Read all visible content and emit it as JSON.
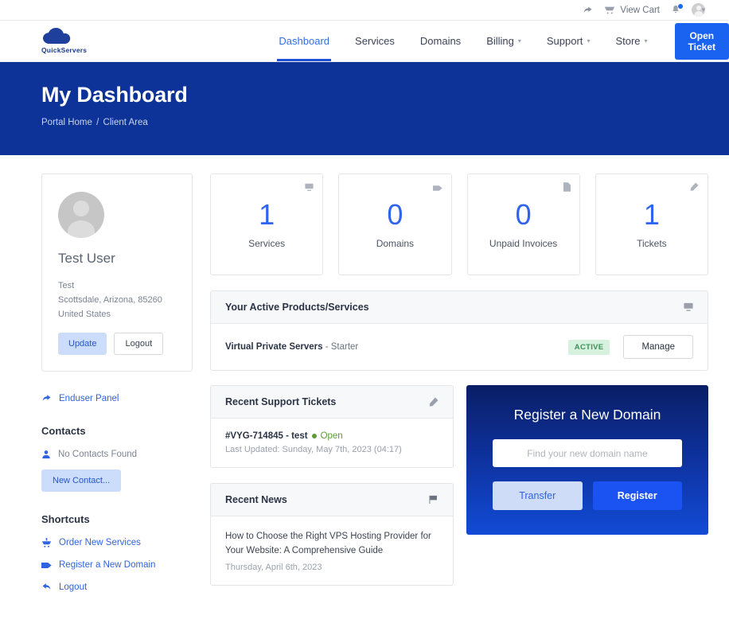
{
  "topbar": {
    "share_icon": "share-arrow-icon",
    "cart_icon": "shopping-cart-icon",
    "cart_label": "View Cart",
    "bell_icon": "bell-icon",
    "avatar_icon": "user-avatar-icon",
    "caret_icon": "chevron-down-icon"
  },
  "brand": {
    "logo_icon": "cloud-logo-icon",
    "name": "QuickServers"
  },
  "nav": {
    "items": [
      {
        "label": "Dashboard",
        "active": true,
        "caret": false
      },
      {
        "label": "Services",
        "active": false,
        "caret": false
      },
      {
        "label": "Domains",
        "active": false,
        "caret": false
      },
      {
        "label": "Billing",
        "active": false,
        "caret": true
      },
      {
        "label": "Support",
        "active": false,
        "caret": true
      },
      {
        "label": "Store",
        "active": false,
        "caret": true
      }
    ],
    "open_ticket_label": "Open Ticket"
  },
  "hero": {
    "title": "My Dashboard",
    "breadcrumb": [
      "Portal Home",
      "Client Area"
    ],
    "separator": "/",
    "bg_color": "#0d3398"
  },
  "profile": {
    "avatar_icon": "user-avatar-icon",
    "name": "Test User",
    "company": "Test",
    "address": "Scottsdale, Arizona, 85260",
    "country": "United States",
    "update_label": "Update",
    "logout_label": "Logout"
  },
  "sidebar": {
    "enduser_panel": {
      "label": "Enduser Panel",
      "icon": "arrow-forward-icon"
    },
    "contacts_heading": "Contacts",
    "contacts_empty": {
      "label": "No Contacts Found",
      "icon": "user-icon"
    },
    "new_contact_label": "New Contact...",
    "shortcuts_heading": "Shortcuts",
    "shortcuts": [
      {
        "label": "Order New Services",
        "icon": "cart-plus-icon"
      },
      {
        "label": "Register a New Domain",
        "icon": "tag-icon"
      },
      {
        "label": "Logout",
        "icon": "arrow-back-icon"
      }
    ]
  },
  "stats": [
    {
      "value": "1",
      "label": "Services",
      "icon": "server-icon"
    },
    {
      "value": "0",
      "label": "Domains",
      "icon": "tag-icon"
    },
    {
      "value": "0",
      "label": "Unpaid Invoices",
      "icon": "file-icon"
    },
    {
      "value": "1",
      "label": "Tickets",
      "icon": "ticket-icon"
    }
  ],
  "services_panel": {
    "title": "Your Active Products/Services",
    "icon": "server-icon",
    "rows": [
      {
        "product": "Virtual Private Servers",
        "plan": " - Starter",
        "status": "ACTIVE",
        "action_label": "Manage"
      }
    ]
  },
  "tickets_panel": {
    "title": "Recent Support Tickets",
    "icon": "ticket-icon",
    "rows": [
      {
        "id": "#VYG-714845 - test",
        "status": "Open",
        "updated": "Last Updated: Sunday, May 7th, 2023 (04:17)"
      }
    ]
  },
  "news_panel": {
    "title": "Recent News",
    "icon": "flag-icon",
    "rows": [
      {
        "headline": "How to Choose the Right VPS Hosting Provider for Your Website: A Comprehensive Guide",
        "date": "Thursday, April 6th, 2023"
      }
    ]
  },
  "domain_panel": {
    "title": "Register a New Domain",
    "input_value": "",
    "input_placeholder": "Find your new domain name",
    "transfer_label": "Transfer",
    "register_label": "Register"
  },
  "colors": {
    "brand_blue": "#0d3398",
    "accent_blue": "#1a62f0",
    "link_blue": "#2f63e0",
    "status_green": "#5f9a37",
    "badge_green_bg": "#d6f2de"
  }
}
